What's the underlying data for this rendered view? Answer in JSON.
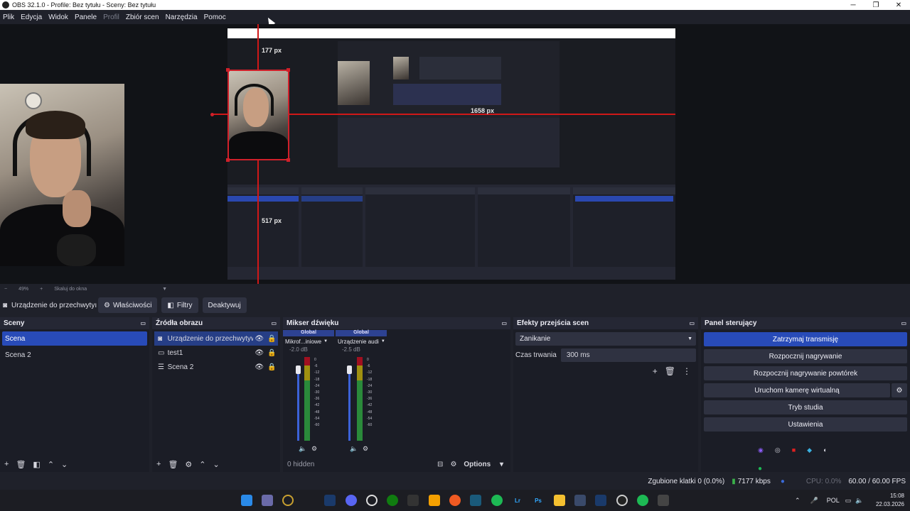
{
  "window": {
    "title": "OBS 32.1.0 - Profile: Bez tytułu - Sceny: Bez tytułu",
    "minimize": "─",
    "maximize": "❐",
    "close": "✕"
  },
  "menu": {
    "items": [
      "Plik",
      "Edycja",
      "Widok",
      "Panele",
      "Profil",
      "Zbiór scen",
      "Narzędzia",
      "Pomoc"
    ]
  },
  "preview": {
    "measure_top": "177 px",
    "measure_right": "1658 px",
    "measure_bottom": "517 px"
  },
  "zoom": {
    "minus": "−",
    "level": "49%",
    "plus": "+",
    "mode": "Skaluj do okna",
    "caret": "▼"
  },
  "source_toolbar": {
    "source_name": "Urządzenie do przechwytyı",
    "properties": "Właściwości",
    "filters": "Filtry",
    "deactivate": "Deaktywuj"
  },
  "scenes": {
    "title": "Sceny",
    "items": [
      "Scena",
      "Scena 2"
    ]
  },
  "sources": {
    "title": "Źródła obrazu",
    "items": [
      "Urządzenie do przechwytywar",
      "test1",
      "Scena 2"
    ]
  },
  "mixer": {
    "title": "Mikser dźwięku",
    "channels": [
      {
        "global": "Global",
        "name": "Mikrof...iniowe",
        "db": "-2.0 dB",
        "level": 0.6
      },
      {
        "global": "Global",
        "name": "Urządzenie audi",
        "db": "-2.5 dB",
        "level": 0.6
      }
    ],
    "scale": [
      "0",
      "-6",
      "-12",
      "-18",
      "-24",
      "-30",
      "-36",
      "-42",
      "-48",
      "-54",
      "-60"
    ],
    "hidden": "0 hidden",
    "options": "Options"
  },
  "transitions": {
    "title": "Efekty przejścia scen",
    "selected": "Zanikanie",
    "duration_label": "Czas trwania",
    "duration_value": "300 ms"
  },
  "controls": {
    "title": "Panel sterujący",
    "stop_stream": "Zatrzymaj transmisję",
    "start_recording": "Rozpocznij nagrywanie",
    "start_replay": "Rozpocznij nagrywanie powtórek",
    "start_virtualcam": "Uruchom kamerę wirtualną",
    "studio_mode": "Tryb studia",
    "settings": "Ustawienia"
  },
  "status": {
    "dropped": "Zgubione klatki 0 (0.0%)",
    "bitrate": "7177 kbps",
    "cpu": "CPU: 0.0%",
    "fps": "60.00 / 60.00 FPS"
  },
  "taskbar": {
    "lang": "POL",
    "time": "15:08",
    "date": "22.03.2026"
  },
  "colors": {
    "accent": "#284bb8",
    "selection": "#d0202a",
    "background": "#1f212a"
  }
}
